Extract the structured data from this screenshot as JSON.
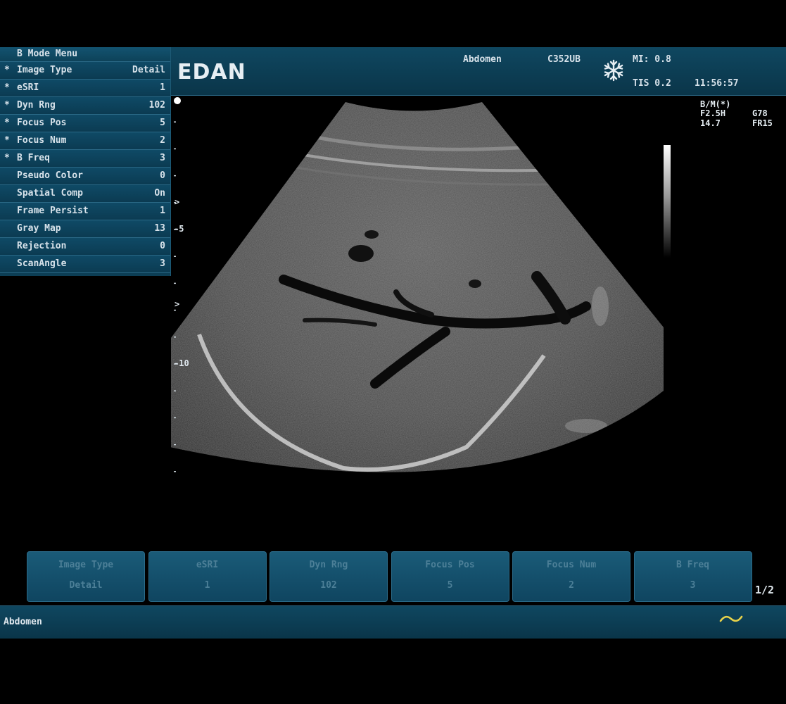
{
  "header": {
    "logo": "EDAN",
    "preset": "Abdomen",
    "probe": "C352UB",
    "mi": "MI: 0.8",
    "tis": "TIS 0.2",
    "time": "11:56:57",
    "freeze_icon": "snowflake-icon"
  },
  "menu": {
    "title": "B Mode Menu",
    "items": [
      {
        "star": "*",
        "label": "Image Type",
        "value": "Detail"
      },
      {
        "star": "*",
        "label": "eSRI",
        "value": "1"
      },
      {
        "star": "*",
        "label": "Dyn Rng",
        "value": "102"
      },
      {
        "star": "*",
        "label": "Focus Pos",
        "value": "5"
      },
      {
        "star": "*",
        "label": "Focus Num",
        "value": "2"
      },
      {
        "star": "*",
        "label": "B Freq",
        "value": "3"
      },
      {
        "star": "",
        "label": "Pseudo Color",
        "value": "0"
      },
      {
        "star": "",
        "label": "Spatial Comp",
        "value": "On"
      },
      {
        "star": "",
        "label": "Frame Persist",
        "value": "1"
      },
      {
        "star": "",
        "label": "Gray Map",
        "value": "13"
      },
      {
        "star": "",
        "label": "Rejection",
        "value": "0"
      },
      {
        "star": "",
        "label": "ScanAngle",
        "value": "3"
      }
    ]
  },
  "image_params": {
    "mode": "B/M(*)",
    "freq": "F2.5H",
    "gain": "G78",
    "depth": "14.7",
    "frame_rate": "FR15"
  },
  "depth_scale": {
    "marks": [
      {
        "label": "-5",
        "depth_cm": 5
      },
      {
        "label": "-10",
        "depth_cm": 10
      }
    ],
    "focus_markers": [
      {
        "label": ">",
        "depth_cm": 4
      },
      {
        "label": ">",
        "depth_cm": 7.8
      }
    ]
  },
  "softkeys": [
    {
      "label": "Image Type",
      "value": "Detail"
    },
    {
      "label": "eSRI",
      "value": "1"
    },
    {
      "label": "Dyn Rng",
      "value": "102"
    },
    {
      "label": "Focus Pos",
      "value": "5"
    },
    {
      "label": "Focus Num",
      "value": "2"
    },
    {
      "label": "B Freq",
      "value": "3"
    }
  ],
  "page_indicator": "1/2",
  "status": {
    "text": "Abdomen",
    "wave_icon": "tilde-wave-icon",
    "wave_color": "#e8d24a"
  }
}
